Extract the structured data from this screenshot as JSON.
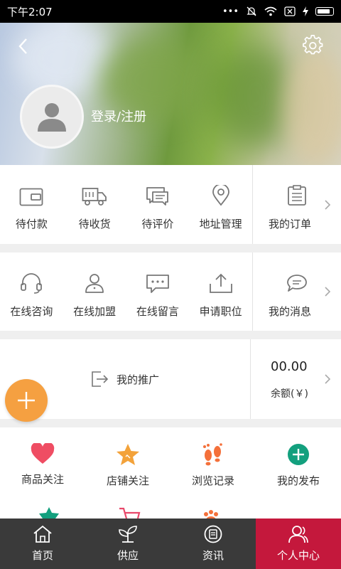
{
  "status_bar": {
    "time": "下午2:07",
    "dots": "•••"
  },
  "header": {
    "login_label": "登录/注册"
  },
  "orders": {
    "items": [
      {
        "label": "待付款",
        "icon": "wallet-icon"
      },
      {
        "label": "待收货",
        "icon": "truck-icon"
      },
      {
        "label": "待评价",
        "icon": "review-icon"
      },
      {
        "label": "地址管理",
        "icon": "location-pin-icon"
      }
    ],
    "side_label": "我的订单"
  },
  "services": {
    "items": [
      {
        "label": "在线咨询",
        "icon": "headset-icon"
      },
      {
        "label": "在线加盟",
        "icon": "user-icon"
      },
      {
        "label": "在线留言",
        "icon": "message-icon"
      },
      {
        "label": "申请职位",
        "icon": "upload-icon"
      }
    ],
    "side_label": "我的消息"
  },
  "promotion": {
    "label": "我的推广"
  },
  "balance": {
    "amount": "00.00",
    "label": "余额(￥)"
  },
  "favorites": {
    "items": [
      {
        "label": "商品关注",
        "icon": "heart-icon",
        "color": "#ef4d63"
      },
      {
        "label": "店铺关注",
        "icon": "star-icon",
        "color": "#f3a23a"
      },
      {
        "label": "浏览记录",
        "icon": "footprint-icon",
        "color": "#f4703a"
      },
      {
        "label": "我的发布",
        "icon": "plus-circle-icon",
        "color": "#13a07e"
      }
    ]
  },
  "tabbar": {
    "tabs": [
      {
        "label": "首页",
        "icon": "home-icon"
      },
      {
        "label": "供应",
        "icon": "plant-icon"
      },
      {
        "label": "资讯",
        "icon": "news-icon"
      },
      {
        "label": "个人中心",
        "icon": "person-icon"
      }
    ],
    "active_color": "#c4183c"
  }
}
